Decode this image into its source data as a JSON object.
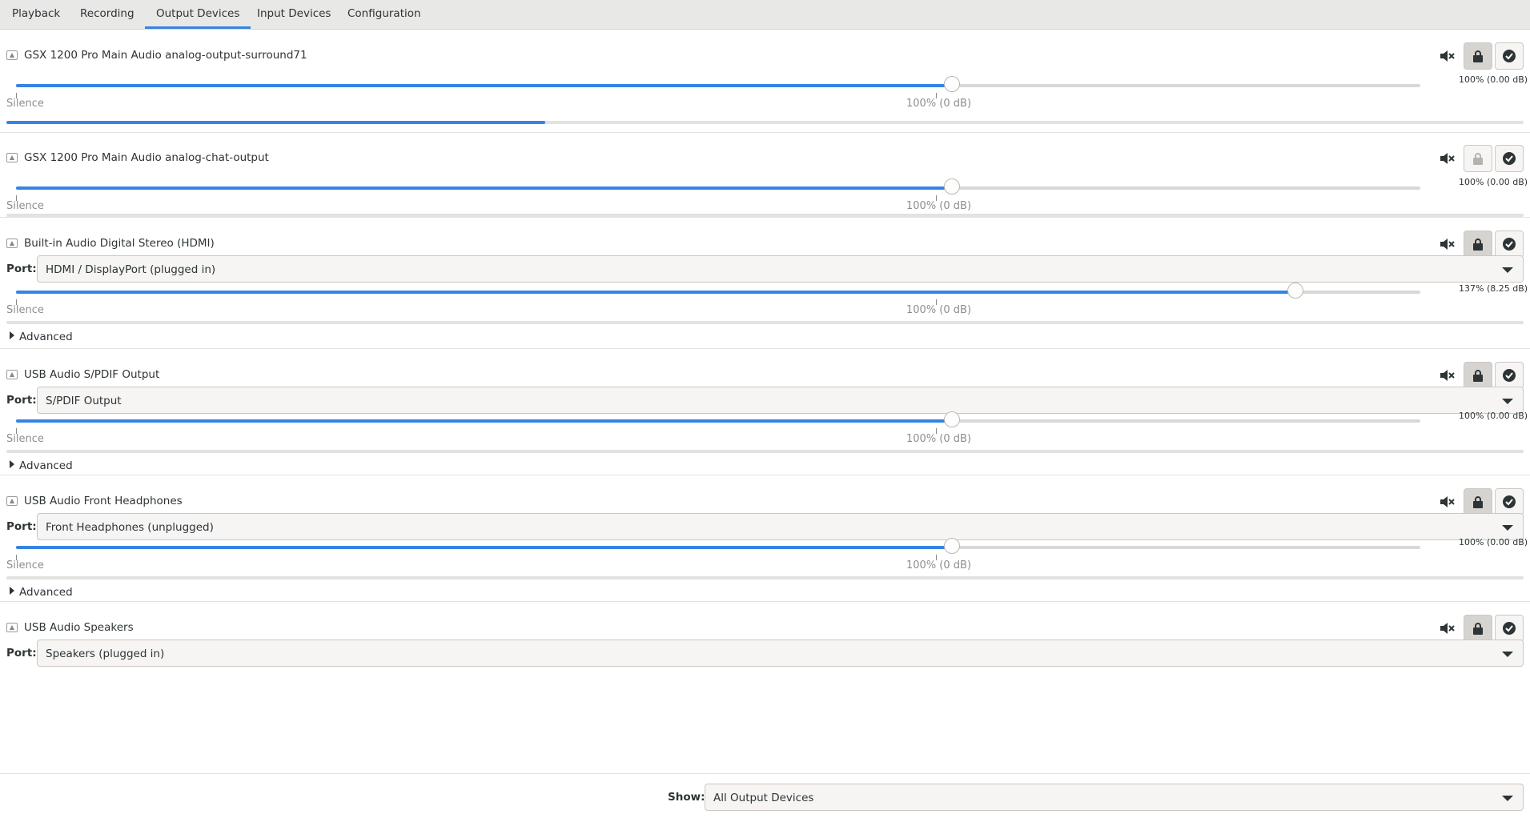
{
  "tabs": [
    {
      "label": "Playback",
      "active": false
    },
    {
      "label": "Recording",
      "active": false
    },
    {
      "label": "Output Devices",
      "active": true
    },
    {
      "label": "Input Devices",
      "active": false
    },
    {
      "label": "Configuration",
      "active": false
    }
  ],
  "scale": {
    "silence_label": "Silence",
    "norm_label": "100% (0 dB)"
  },
  "port_label": "Port:",
  "advanced_label": "Advanced",
  "devices": [
    {
      "name": "GSX 1200 Pro Main Audio analog-output-surround71",
      "volume_text": "100% (0.00 dB)",
      "volume_fraction": 0.6667,
      "meter_fraction": 0.355,
      "lock_pressed": true
    },
    {
      "name": "GSX 1200 Pro Main Audio analog-chat-output",
      "volume_text": "100% (0.00 dB)",
      "volume_fraction": 0.6667,
      "meter_fraction": 0,
      "lock_pressed": false
    },
    {
      "name": "Built-in Audio Digital Stereo (HDMI)",
      "port": "HDMI / DisplayPort (plugged in)",
      "volume_text": "137% (8.25 dB)",
      "volume_fraction": 0.9111,
      "meter_fraction": 0,
      "lock_pressed": true
    },
    {
      "name": "USB Audio S/PDIF Output",
      "port": "S/PDIF Output",
      "volume_text": "100% (0.00 dB)",
      "volume_fraction": 0.6667,
      "meter_fraction": 0,
      "lock_pressed": true
    },
    {
      "name": "USB Audio Front Headphones",
      "port": "Front Headphones (unplugged)",
      "volume_text": "100% (0.00 dB)",
      "volume_fraction": 0.6667,
      "meter_fraction": 0,
      "lock_pressed": true
    },
    {
      "name": "USB Audio Speakers",
      "port": "Speakers (plugged in)",
      "lock_pressed": true
    }
  ],
  "footer": {
    "show_label": "Show:",
    "show_value": "All Output Devices"
  },
  "colors": {
    "accent": "#3584e4"
  },
  "icons": {
    "mute": "speaker-muted-icon",
    "lock": "lock-icon",
    "default": "check-circle-icon",
    "device": "audio-device-icon",
    "dropdown": "dropdown-caret-icon",
    "expander": "triangle-right-icon"
  }
}
